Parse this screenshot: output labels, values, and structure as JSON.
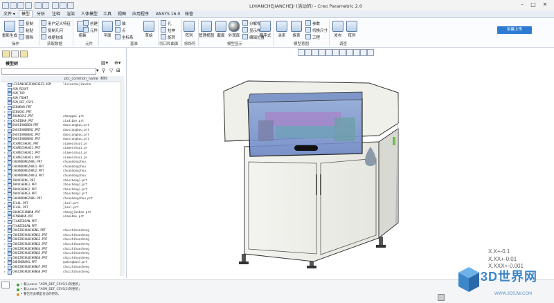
{
  "window": {
    "title": "LIXIANCHEJIANCHEJI (活动的) - Creo Parametric 2.0",
    "controls": [
      "–",
      "□",
      "✕"
    ]
  },
  "menu": {
    "tabs": [
      "文件 ▾",
      "模型",
      "分析",
      "注释",
      "渲染",
      "人体模型",
      "工具",
      "视图",
      "应用程序",
      "ANSYS 16.0",
      "帐管"
    ],
    "active_index": 1
  },
  "ribbon": {
    "regenerate": "重新生成",
    "copy": "复制",
    "paste": "粘贴",
    "delete": "删除",
    "user_defined_feature": "用户定义特征",
    "copy_geometry": "复制几何",
    "shrinkwrap": "收缩包络",
    "assemble": "组装",
    "create": "创建",
    "component_interface": "元件",
    "plane": "平面",
    "axis": "轴",
    "point": "点",
    "coord_sys": "坐标系",
    "sketch": "草绘",
    "hole": "孔",
    "extrude": "拉伸",
    "revolve": "旋转",
    "pattern": "阵列",
    "manage_views": "管理视图",
    "section": "截面",
    "appearance": "外观库",
    "display_style": "显示样式",
    "edit_position": "编辑位置",
    "split_body": "分解视图",
    "model_intent": "程序式",
    "param": "参数",
    "relations": "关系",
    "switch_dims": "切换尺寸",
    "family_table": "族表",
    "eng_pattern": "工程",
    "sim_probe": "发布",
    "sign_in": "创建上传",
    "groups": [
      "操作",
      "获取数据",
      "元件",
      "基准",
      "切口和曲面",
      "修饰符",
      "模型显示",
      "模型意图",
      "调查"
    ]
  },
  "panel": {
    "title": "模型树",
    "search_placeholder": "",
    "col_name": "",
    "col_file": "ptc_common_name",
    "col_mat": "材料"
  },
  "tree": [
    {
      "name": "LIXIANCHEJIANCHEJI.ASM",
      "file": "lixianchejianche",
      "exp": ""
    },
    {
      "name": "ASM_RIGHT",
      "file": "",
      "exp": ""
    },
    {
      "name": "ASM_TOP",
      "file": "",
      "exp": ""
    },
    {
      "name": "ASM_FRONT",
      "file": "",
      "exp": ""
    },
    {
      "name": "ASM_DEF_CSYS",
      "file": "",
      "exp": ""
    },
    {
      "name": "DIBUBAN.PRT",
      "file": "",
      "exp": "▸"
    },
    {
      "name": "DIBUGAI.PRT",
      "file": "",
      "exp": "▸"
    },
    {
      "name": "ZHANGGAI.PRT",
      "file": "zhanggai.prt",
      "exp": "▸"
    },
    {
      "name": "XIADIBAN.PRT",
      "file": "xiadiban.prt",
      "exp": "▸"
    },
    {
      "name": "DAOXIANGBEN.PRT",
      "file": "daoxiangbau.prt",
      "exp": "▸"
    },
    {
      "name": "DAOXIANGBEN1.PRT",
      "file": "daoxiangbau.prt",
      "exp": "▸"
    },
    {
      "name": "DAOXIANGBEN2.PRT",
      "file": "daoxiangbau.prt",
      "exp": "▸"
    },
    {
      "name": "DAOXIANGBEN3.PRT",
      "file": "daoxiangbau.prt",
      "exp": "▸"
    },
    {
      "name": "XIAMEISHUAI.PRT",
      "file": "xiameishuai.pr",
      "exp": "▸"
    },
    {
      "name": "XIAMEISHUAI1.PRT",
      "file": "xiameishuai.pr",
      "exp": "▸"
    },
    {
      "name": "XIAMEISHUAI2.PRT",
      "file": "xiameishuai.pr",
      "exp": "▸"
    },
    {
      "name": "XIAMEISHUAI3.PRT",
      "file": "xiameishuai.pr",
      "exp": "▸"
    },
    {
      "name": "CHUANDONGZHOU.PRT",
      "file": "chuandongzhou.",
      "exp": "▸"
    },
    {
      "name": "CHUANDONGZHOU1.PRT",
      "file": "chuandongzhou.",
      "exp": "▸"
    },
    {
      "name": "CHUANDONGZHOU2.PRT",
      "file": "chuandongzhou.",
      "exp": "▸"
    },
    {
      "name": "CHUANDONGZHOU3.PRT",
      "file": "chuandongzhou.",
      "exp": "▸"
    },
    {
      "name": "ZHOUCHENG.PRT",
      "file": "zhoucheng1.prt",
      "exp": "▸"
    },
    {
      "name": "ZHOUCHENG1.PRT",
      "file": "zhoucheng1.prt",
      "exp": "▸"
    },
    {
      "name": "ZHOUCHENG2.PRT",
      "file": "zhoucheng1.prt",
      "exp": "▸"
    },
    {
      "name": "ZHOUCHENG3.PRT",
      "file": "zhoucheng1.prt",
      "exp": "▸"
    },
    {
      "name": "CHUANDONGZHOU.PRT",
      "file": "chuandongzhou.prt",
      "exp": "▸"
    },
    {
      "name": "JIAOL.PRT",
      "file": "jiaol.prt",
      "exp": "▸"
    },
    {
      "name": "JIAOL.PRT",
      "file": "jiaol.prt",
      "exp": "▸"
    },
    {
      "name": "SHANGJIANBAN.PRT",
      "file": "shangjianban.prt",
      "exp": "▸"
    },
    {
      "name": "XIMENBAN.PRT",
      "file": "ximenban.prt",
      "exp": "▸"
    },
    {
      "name": "FIANZIBIAN.PRT",
      "file": "",
      "exp": "▸"
    },
    {
      "name": "FIANZIBIAN.PRT",
      "file": "",
      "exp": "▸"
    },
    {
      "name": "CHUIZHIHUOCHENG.PRT",
      "file": "chuizhihuocheng",
      "exp": "▸"
    },
    {
      "name": "CHUIZHIHUOCHENG1.PRT",
      "file": "chuizhihuocheng",
      "exp": "▸"
    },
    {
      "name": "CHUIZHIHUOCHENG2.PRT",
      "file": "chuizhihuocheng",
      "exp": "▸"
    },
    {
      "name": "CHUIZHIHUOCHENG3.PRT",
      "file": "chuizhihuocheng",
      "exp": "▸"
    },
    {
      "name": "CHUIZHIHUOCHENG4.PRT",
      "file": "chuizhihuocheng",
      "exp": "▸"
    },
    {
      "name": "CHUIZHIHUOCHENG5.PRT",
      "file": "chuizhihuocheng",
      "exp": "▸"
    },
    {
      "name": "CHUIZHIHUOCHENG6.PRT",
      "file": "chuizhihuocheng",
      "exp": "▸"
    },
    {
      "name": "GUDINGBAN1.PRT",
      "file": "gudingban1.prt",
      "exp": "▸"
    },
    {
      "name": "CHUIZHIHUOCHENG7.PRT",
      "file": "chuizhihuocheng",
      "exp": "▸"
    },
    {
      "name": "CHUIZHIHUOCHENG8.PRT",
      "file": "chuizhihuocheng",
      "exp": "▸"
    }
  ],
  "status": {
    "messages": [
      "• 载入zone「ASM_DEF_CSYS(1)的更新」",
      "• 载入zone「ASM_DEF_CSYS(2)的更新」",
      "• 警告在此模型合边的更改。"
    ]
  },
  "tolerance": [
    "X.X+-0.1",
    "X.XX+-0.01",
    "X.XXX+-0.001"
  ],
  "watermark": {
    "title": "3D世界网",
    "url": "WWW.3DSJW.COM"
  }
}
